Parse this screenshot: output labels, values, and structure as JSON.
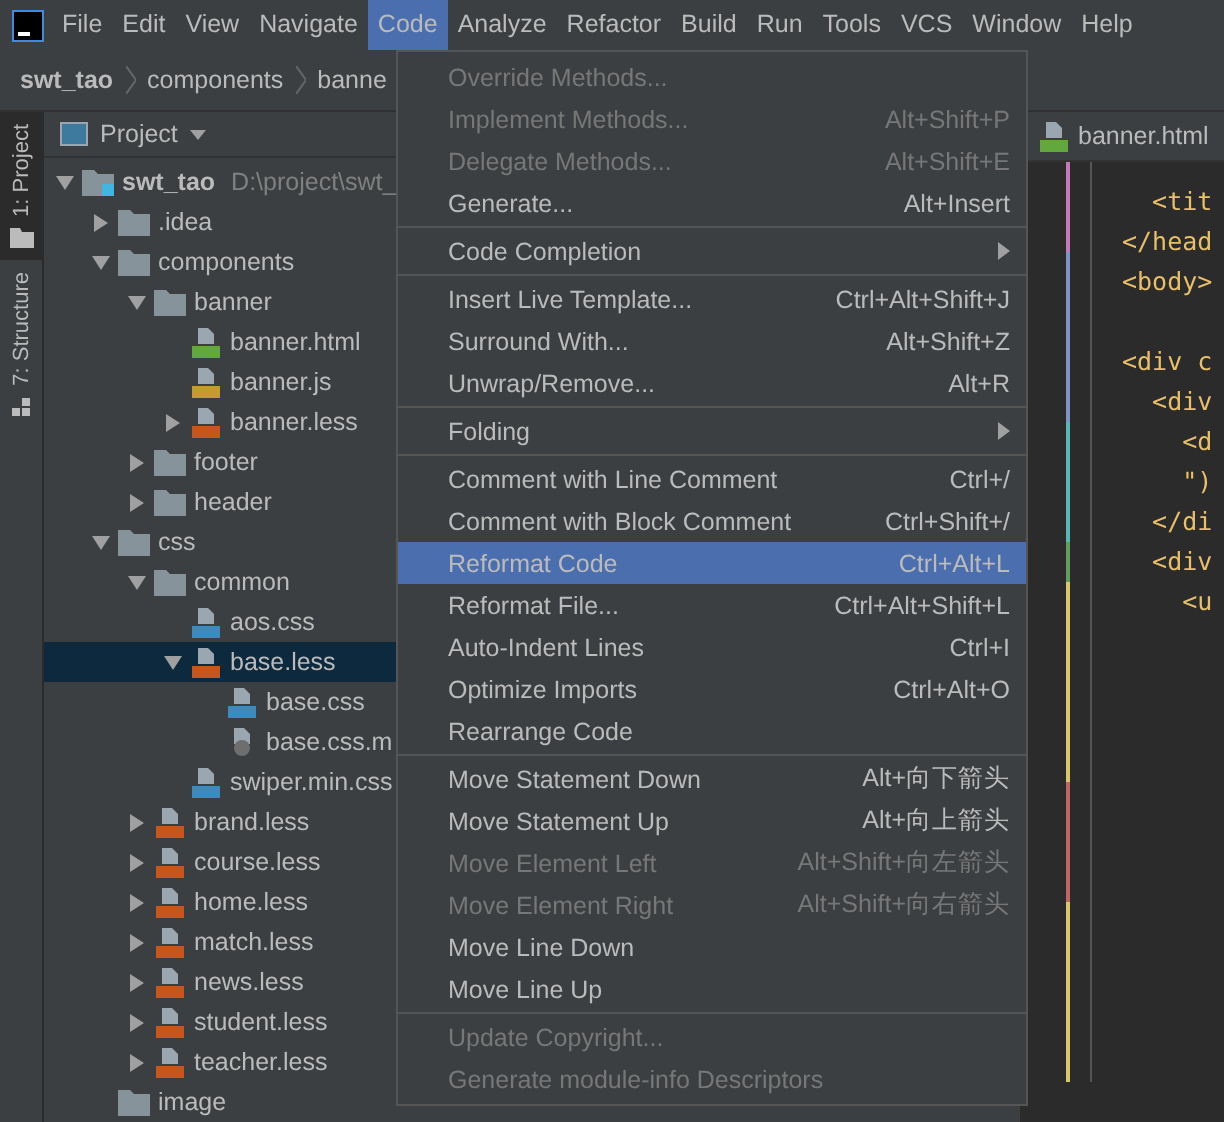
{
  "menu_bar": [
    {
      "label": "File",
      "selected": false
    },
    {
      "label": "Edit",
      "selected": false
    },
    {
      "label": "View",
      "selected": false
    },
    {
      "label": "Navigate",
      "selected": false
    },
    {
      "label": "Code",
      "selected": true
    },
    {
      "label": "Analyze",
      "selected": false
    },
    {
      "label": "Refactor",
      "selected": false
    },
    {
      "label": "Build",
      "selected": false
    },
    {
      "label": "Run",
      "selected": false
    },
    {
      "label": "Tools",
      "selected": false
    },
    {
      "label": "VCS",
      "selected": false
    },
    {
      "label": "Window",
      "selected": false
    },
    {
      "label": "Help",
      "selected": false
    }
  ],
  "breadcrumb": [
    "swt_tao",
    "components",
    "banne"
  ],
  "tool_strip": [
    {
      "label": "1: Project",
      "selected": true,
      "kind": "folder"
    },
    {
      "label": "7: Structure",
      "selected": false,
      "kind": "structure"
    }
  ],
  "project_panel": {
    "title": "Project",
    "tree": [
      {
        "name": "swt_tao",
        "path": "D:\\project\\swt_",
        "kind": "module",
        "expanded": true,
        "selected": false,
        "children": [
          {
            "name": ".idea",
            "kind": "folder",
            "expanded": false,
            "selected": false
          },
          {
            "name": "components",
            "kind": "folder",
            "expanded": true,
            "selected": false,
            "children": [
              {
                "name": "banner",
                "kind": "folder",
                "expanded": true,
                "selected": false,
                "children": [
                  {
                    "name": "banner.html",
                    "kind": "html",
                    "selected": false
                  },
                  {
                    "name": "banner.js",
                    "kind": "js",
                    "selected": false
                  },
                  {
                    "name": "banner.less",
                    "kind": "less",
                    "expanded": false,
                    "selected": false
                  }
                ]
              },
              {
                "name": "footer",
                "kind": "folder",
                "expanded": false,
                "selected": false
              },
              {
                "name": "header",
                "kind": "folder",
                "expanded": false,
                "selected": false
              }
            ]
          },
          {
            "name": "css",
            "kind": "folder",
            "expanded": true,
            "selected": false,
            "children": [
              {
                "name": "common",
                "kind": "folder",
                "expanded": true,
                "selected": false,
                "children": [
                  {
                    "name": "aos.css",
                    "kind": "css",
                    "selected": false
                  },
                  {
                    "name": "base.less",
                    "kind": "less",
                    "expanded": true,
                    "selected": true,
                    "children": [
                      {
                        "name": "base.css",
                        "kind": "css",
                        "selected": false
                      },
                      {
                        "name": "base.css.m",
                        "kind": "map",
                        "selected": false
                      }
                    ]
                  },
                  {
                    "name": "swiper.min.css",
                    "kind": "css",
                    "selected": false
                  }
                ]
              },
              {
                "name": "brand.less",
                "kind": "less",
                "expanded": false,
                "selected": false
              },
              {
                "name": "course.less",
                "kind": "less",
                "expanded": false,
                "selected": false
              },
              {
                "name": "home.less",
                "kind": "less",
                "expanded": false,
                "selected": false
              },
              {
                "name": "match.less",
                "kind": "less",
                "expanded": false,
                "selected": false
              },
              {
                "name": "news.less",
                "kind": "less",
                "expanded": false,
                "selected": false
              },
              {
                "name": "student.less",
                "kind": "less",
                "expanded": false,
                "selected": false
              },
              {
                "name": "teacher.less",
                "kind": "less",
                "expanded": false,
                "selected": false
              }
            ]
          },
          {
            "name": "image",
            "kind": "folder",
            "selected": false
          }
        ]
      }
    ]
  },
  "editor": {
    "tab": "banner.html",
    "blocks": [
      [
        "  <tit",
        "</head",
        "<body>"
      ],
      [
        "<div c",
        "  <div",
        "    <d",
        "    \")",
        "  </di",
        "  <div",
        "    <u"
      ]
    ]
  },
  "code_menu": [
    [
      {
        "label": "Override Methods...",
        "disabled": true,
        "selected": false,
        "kind": "item"
      },
      {
        "label": "Implement Methods...",
        "shortcut": "Alt+Shift+P",
        "disabled": true,
        "selected": false,
        "kind": "item"
      },
      {
        "label": "Delegate Methods...",
        "shortcut": "Alt+Shift+E",
        "disabled": true,
        "selected": false,
        "kind": "item"
      },
      {
        "label": "Generate...",
        "shortcut": "Alt+Insert",
        "disabled": false,
        "selected": false,
        "kind": "item"
      }
    ],
    [
      {
        "label": "Code Completion",
        "disabled": false,
        "selected": false,
        "kind": "submenu"
      }
    ],
    [
      {
        "label": "Insert Live Template...",
        "shortcut": "Ctrl+Alt+Shift+J",
        "disabled": false,
        "selected": false,
        "kind": "item"
      },
      {
        "label": "Surround With...",
        "shortcut": "Alt+Shift+Z",
        "disabled": false,
        "selected": false,
        "kind": "item"
      },
      {
        "label": "Unwrap/Remove...",
        "shortcut": "Alt+R",
        "disabled": false,
        "selected": false,
        "kind": "item"
      }
    ],
    [
      {
        "label": "Folding",
        "disabled": false,
        "selected": false,
        "kind": "submenu"
      }
    ],
    [
      {
        "label": "Comment with Line Comment",
        "shortcut": "Ctrl+/",
        "disabled": false,
        "selected": false,
        "kind": "item"
      },
      {
        "label": "Comment with Block Comment",
        "shortcut": "Ctrl+Shift+/",
        "disabled": false,
        "selected": false,
        "kind": "item"
      },
      {
        "label": "Reformat Code",
        "shortcut": "Ctrl+Alt+L",
        "disabled": false,
        "selected": true,
        "kind": "item"
      },
      {
        "label": "Reformat File...",
        "shortcut": "Ctrl+Alt+Shift+L",
        "disabled": false,
        "selected": false,
        "kind": "item"
      },
      {
        "label": "Auto-Indent Lines",
        "shortcut": "Ctrl+I",
        "disabled": false,
        "selected": false,
        "kind": "item"
      },
      {
        "label": "Optimize Imports",
        "shortcut": "Ctrl+Alt+O",
        "disabled": false,
        "selected": false,
        "kind": "item"
      },
      {
        "label": "Rearrange Code",
        "disabled": false,
        "selected": false,
        "kind": "item"
      }
    ],
    [
      {
        "label": "Move Statement Down",
        "shortcut": "Alt+向下箭头",
        "disabled": false,
        "selected": false,
        "kind": "item"
      },
      {
        "label": "Move Statement Up",
        "shortcut": "Alt+向上箭头",
        "disabled": false,
        "selected": false,
        "kind": "item"
      },
      {
        "label": "Move Element Left",
        "shortcut": "Alt+Shift+向左箭头",
        "disabled": true,
        "selected": false,
        "kind": "item"
      },
      {
        "label": "Move Element Right",
        "shortcut": "Alt+Shift+向右箭头",
        "disabled": true,
        "selected": false,
        "kind": "item"
      },
      {
        "label": "Move Line Down",
        "disabled": false,
        "selected": false,
        "kind": "item"
      },
      {
        "label": "Move Line Up",
        "disabled": false,
        "selected": false,
        "kind": "item"
      }
    ],
    [
      {
        "label": "Update Copyright...",
        "disabled": true,
        "selected": false,
        "kind": "item"
      },
      {
        "label": "Generate module-info Descriptors",
        "disabled": true,
        "selected": false,
        "kind": "item"
      }
    ]
  ]
}
